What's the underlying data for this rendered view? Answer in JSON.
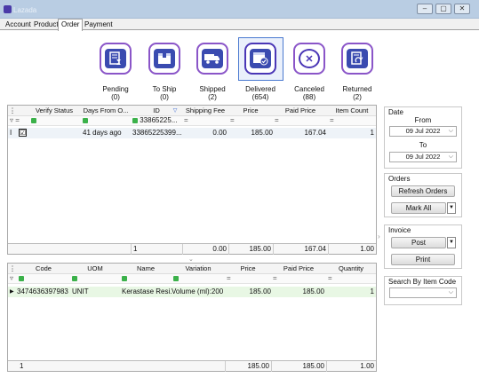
{
  "window": {
    "title": "Lazada",
    "buttons": [
      "‒",
      "▢",
      "✕"
    ]
  },
  "tabs": [
    "Account",
    "Product",
    "Order",
    "Payment"
  ],
  "active_tab": "Order",
  "status_filters": [
    {
      "label": "Pending",
      "count": "(0)",
      "icon": "invoice-hourglass-icon"
    },
    {
      "label": "To Ship",
      "count": "(0)",
      "icon": "box-icon"
    },
    {
      "label": "Shipped",
      "count": "(2)",
      "icon": "truck-icon"
    },
    {
      "label": "Delivered",
      "count": "(654)",
      "icon": "box-check-icon"
    },
    {
      "label": "Canceled",
      "count": "(88)",
      "icon": "cancel-circle-icon"
    },
    {
      "label": "Returned",
      "count": "(2)",
      "icon": "return-document-icon"
    }
  ],
  "orders_grid": {
    "columns": [
      "Verify Status",
      "Days From O...",
      "ID",
      "Shipping Fee",
      "Price",
      "Paid Price",
      "Item Count"
    ],
    "filter_id": "33865225...",
    "rows": [
      {
        "days": "41 days ago",
        "id": "33865225399...",
        "shipping_fee": "0.00",
        "price": "185.00",
        "paid_price": "167.04",
        "item_count": "1"
      }
    ],
    "footer": {
      "count": "1",
      "shipping_fee": "0.00",
      "price": "185.00",
      "paid_price": "167.04",
      "item_count": "1.00"
    }
  },
  "items_grid": {
    "columns": [
      "Code",
      "UOM",
      "Name",
      "Variation",
      "Price",
      "Paid Price",
      "Quantity"
    ],
    "rows": [
      {
        "code": "3474636397983",
        "uom": "UNIT",
        "name": "Kerastase Resi...",
        "variation": "Volume (ml):200",
        "price": "185.00",
        "paid_price": "185.00",
        "quantity": "1"
      }
    ],
    "footer": {
      "count": "1",
      "price": "185.00",
      "paid_price": "185.00",
      "quantity": "1.00"
    }
  },
  "date_panel": {
    "title": "Date",
    "from_label": "From",
    "from_value": "09 Jul 2022",
    "to_label": "To",
    "to_value": "09 Jul 2022"
  },
  "orders_panel": {
    "title": "Orders",
    "refresh_label": "Refresh Orders",
    "mark_all_label": "Mark All"
  },
  "invoice_panel": {
    "title": "Invoice",
    "post_label": "Post",
    "print_label": "Print"
  },
  "search_panel": {
    "title": "Search By Item Code",
    "value": ""
  }
}
